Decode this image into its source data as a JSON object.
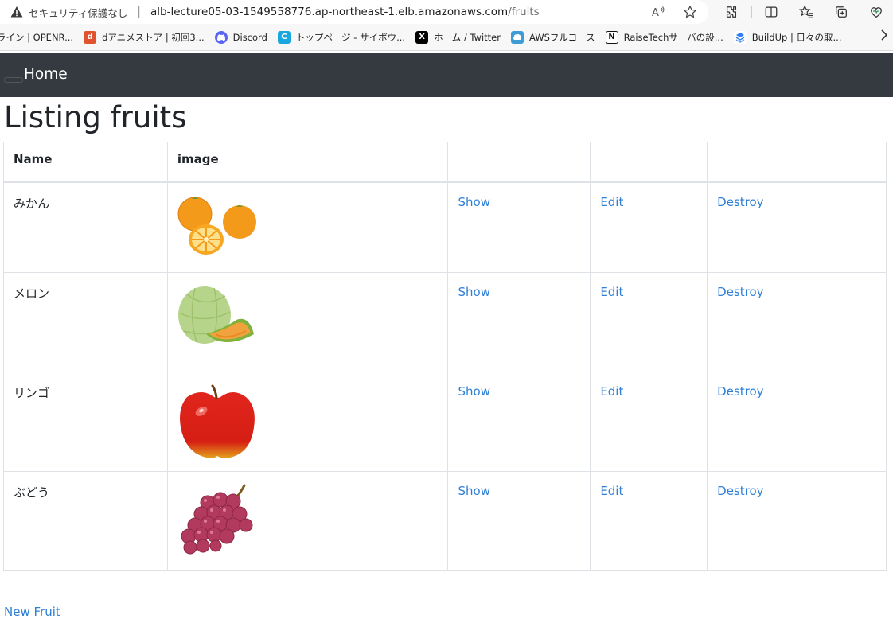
{
  "browser": {
    "security_label": "セキュリティ保護なし",
    "url_host": "alb-lecture05-03-1549558776.ap-northeast-1.elb.amazonaws.com",
    "url_path": "/fruits"
  },
  "bookmarks": [
    {
      "label": "ライン | OPENR...",
      "icon": "generic-icon",
      "color": "#4a8f3c"
    },
    {
      "label": "dアニメストア | 初回3...",
      "icon": "danime-icon",
      "color": "#e0532f"
    },
    {
      "label": "Discord",
      "icon": "discord-icon",
      "color": "#5865f2"
    },
    {
      "label": "トップページ - サイボウ...",
      "icon": "cybozu-icon",
      "color": "#1aa7e0"
    },
    {
      "label": "ホーム / Twitter",
      "icon": "x-icon",
      "color": "#000000"
    },
    {
      "label": "AWSフルコース",
      "icon": "aws-icon",
      "color": "#3d9bd6"
    },
    {
      "label": "RaiseTechサーバの設...",
      "icon": "notion-icon",
      "color": "#111111"
    },
    {
      "label": "BuildUp | 日々の取...",
      "icon": "buildup-icon",
      "color": "#2d7ff9"
    }
  ],
  "navbar": {
    "brand": "Home"
  },
  "page": {
    "title": "Listing fruits"
  },
  "table": {
    "headers": [
      "Name",
      "image",
      "",
      "",
      ""
    ],
    "rows": [
      {
        "name": "みかん",
        "image": "mandarin-orange-image",
        "show": "Show",
        "edit": "Edit",
        "destroy": "Destroy"
      },
      {
        "name": "メロン",
        "image": "melon-image",
        "show": "Show",
        "edit": "Edit",
        "destroy": "Destroy"
      },
      {
        "name": "リンゴ",
        "image": "apple-image",
        "show": "Show",
        "edit": "Edit",
        "destroy": "Destroy"
      },
      {
        "name": "ぶどう",
        "image": "grapes-image",
        "show": "Show",
        "edit": "Edit",
        "destroy": "Destroy"
      }
    ]
  },
  "links": {
    "new_fruit": "New Fruit"
  },
  "colors": {
    "navbar": "#343a40",
    "link": "#2f7fd6",
    "border": "#dee2e6"
  }
}
